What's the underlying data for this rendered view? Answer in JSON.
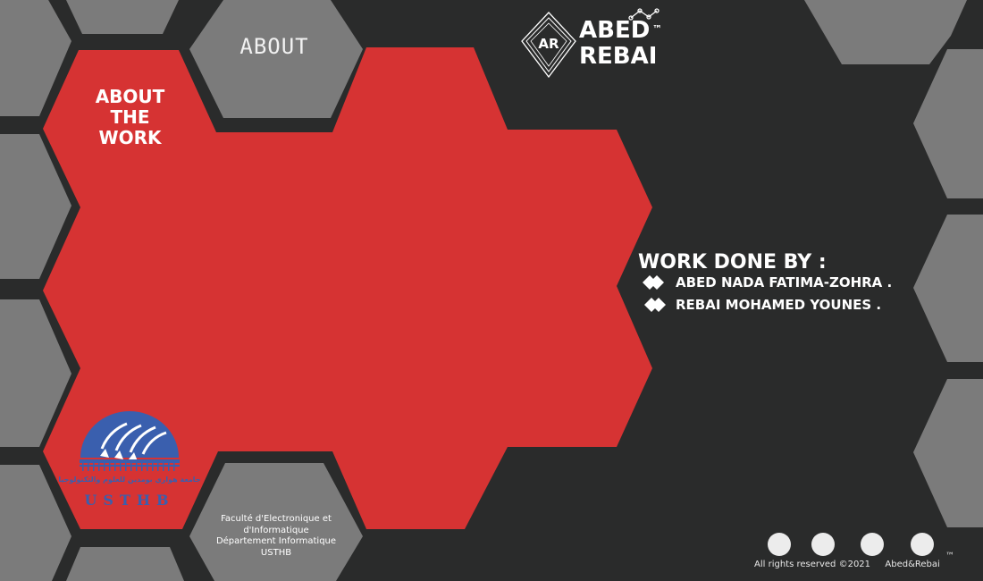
{
  "nav": {
    "about_label": "ABOUT"
  },
  "section": {
    "title_line1": "ABOUT",
    "title_line2": "THE",
    "title_line3": "WORK"
  },
  "brand": {
    "monogram": "AR",
    "line1": "ABED",
    "line2": "REBAI",
    "trademark": "™"
  },
  "work": {
    "title": "WORK DONE BY :",
    "authors": [
      "ABED NADA FATIMA-ZOHRA .",
      "REBAI MOHAMED YOUNES ."
    ]
  },
  "university": {
    "logo_arabic": "جامعة هواري بومدين للعلوم والتكنولوجيا",
    "logo_latin": "USTHB",
    "faculty_line1": "Faculté d'Electronique et",
    "faculty_line2": "d'Informatique",
    "faculty_line3": "Département Informatique",
    "faculty_line4": "USTHB"
  },
  "footer": {
    "rights": "All rights reserved ©2021",
    "owner": "Abed&Rebai",
    "trademark": "™"
  },
  "colors": {
    "background": "#2a2b2b",
    "grey_hex": "#7b7b7b",
    "red_accent": "#d63333",
    "usthb_blue": "#3a5fae"
  },
  "icons": [
    "brand-logo-icon",
    "chart-line-icon",
    "diamond-bullet-icon",
    "usthb-logo-icon"
  ]
}
